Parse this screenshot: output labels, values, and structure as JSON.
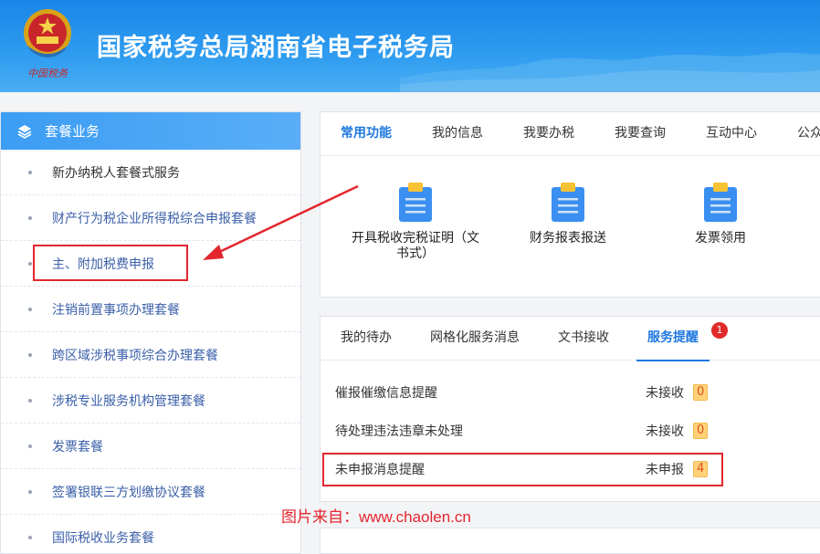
{
  "header": {
    "title": "国家税务总局湖南省电子税务局",
    "emblem_caption": "中国税务"
  },
  "sidebar": {
    "heading": "套餐业务",
    "items": [
      {
        "label": "新办纳税人套餐式服务"
      },
      {
        "label": "财产行为税企业所得税综合申报套餐"
      },
      {
        "label": "主、附加税费申报"
      },
      {
        "label": "注销前置事项办理套餐"
      },
      {
        "label": "跨区域涉税事项综合办理套餐"
      },
      {
        "label": "涉税专业服务机构管理套餐"
      },
      {
        "label": "发票套餐"
      },
      {
        "label": "签署银联三方划缴协议套餐"
      },
      {
        "label": "国际税收业务套餐"
      }
    ]
  },
  "functions": {
    "tabs": [
      "常用功能",
      "我的信息",
      "我要办税",
      "我要查询",
      "互动中心",
      "公众"
    ],
    "active_tab": "常用功能",
    "items": [
      {
        "label_line1": "开具税收完税证明（文",
        "label_line2": "书式）",
        "icon": "clipboard-icon"
      },
      {
        "label_line1": "财务报表报送",
        "label_line2": "",
        "icon": "clipboard-icon"
      },
      {
        "label_line1": "发票领用",
        "label_line2": "",
        "icon": "clipboard-icon"
      }
    ]
  },
  "messages": {
    "tabs": [
      "我的待办",
      "网格化服务消息",
      "文书接收",
      "服务提醒"
    ],
    "active_tab": "服务提醒",
    "active_badge": "1",
    "rows": [
      {
        "label": "催报催缴信息提醒",
        "status": "未接收",
        "count": "0"
      },
      {
        "label": "待处理违法违章未处理",
        "status": "未接收",
        "count": "0"
      },
      {
        "label": "未申报消息提醒",
        "status": "未申报",
        "count": "4"
      }
    ]
  },
  "watermark": "图片来自：www.chaolen.cn",
  "colors": {
    "header_blue": "#1a86e8",
    "accent": "#1f78e0",
    "highlight_red": "#e3262e",
    "count_bg": "#ffd27a"
  }
}
